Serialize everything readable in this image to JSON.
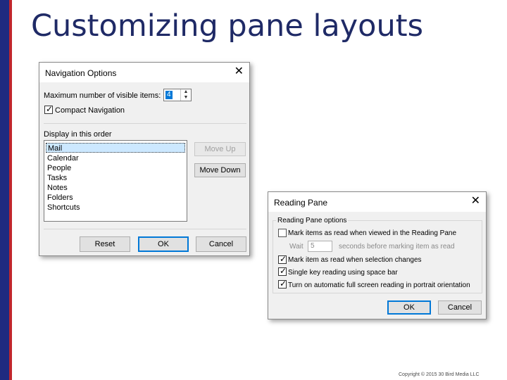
{
  "slide": {
    "title": "Customizing pane layouts",
    "copyright": "Copyright © 2015 30 Bird Media LLC"
  },
  "navigation_options": {
    "title": "Navigation Options",
    "max_items_label": "Maximum number of visible items:",
    "max_items_value": "4",
    "compact_nav_label": "Compact Navigation",
    "compact_nav_checked": true,
    "display_order_label": "Display in this order",
    "items": [
      "Mail",
      "Calendar",
      "People",
      "Tasks",
      "Notes",
      "Folders",
      "Shortcuts"
    ],
    "selected_item": "Mail",
    "move_up_label": "Move Up",
    "move_down_label": "Move Down",
    "reset_label": "Reset",
    "ok_label": "OK",
    "cancel_label": "Cancel"
  },
  "reading_pane": {
    "title": "Reading Pane",
    "group_label": "Reading Pane options",
    "opt_mark_viewed_label": "Mark items as read when viewed in the Reading Pane",
    "opt_mark_viewed_checked": false,
    "wait_label": "Wait",
    "wait_value": "5",
    "wait_suffix": "seconds before marking item as read",
    "opt_mark_selection_label": "Mark item as read when selection changes",
    "opt_mark_selection_checked": true,
    "opt_single_key_label": "Single key reading using space bar",
    "opt_single_key_checked": true,
    "opt_fullscreen_label": "Turn on automatic full screen reading in portrait orientation",
    "opt_fullscreen_checked": true,
    "ok_label": "OK",
    "cancel_label": "Cancel"
  }
}
